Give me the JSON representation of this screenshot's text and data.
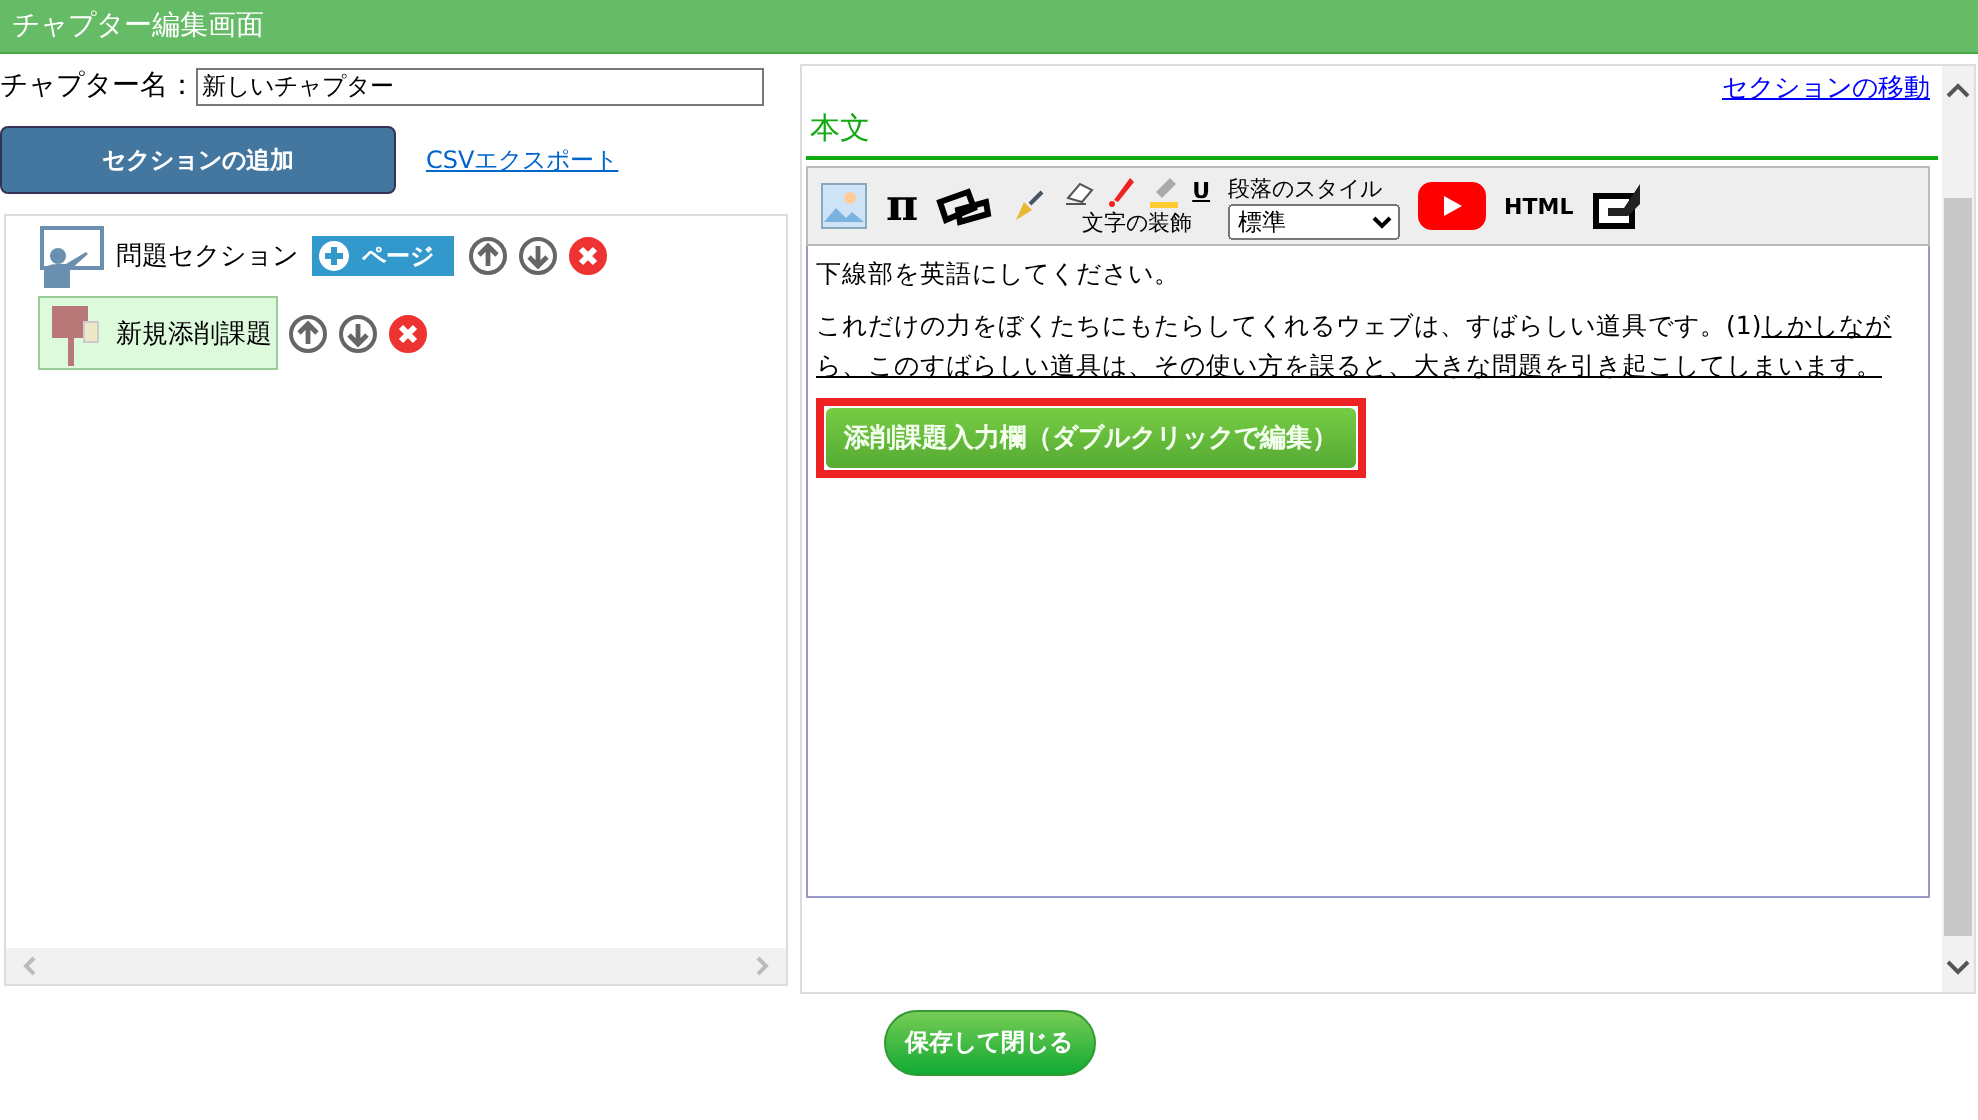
{
  "window": {
    "title": "チャプター編集画面"
  },
  "chapter_name": {
    "label": "チャプター名：",
    "value": "新しいチャプター"
  },
  "add_section_button": "セクションの追加",
  "csv_link": "CSVエクスポート",
  "tree": [
    {
      "kind": "section",
      "label": "問題セクション",
      "page_button": "ページ",
      "selected": false
    },
    {
      "kind": "task",
      "label": "新規添削課題",
      "selected": true
    }
  ],
  "move_section_link": "セクションの移動",
  "body_heading": "本文",
  "toolbar": {
    "pi": "π",
    "underline": "U",
    "decoration_label": "文字の装飾",
    "paragraph_label": "段落のスタイル",
    "paragraph_style": "標準",
    "html": "HTML"
  },
  "editor": {
    "paragraphs": [
      [
        {
          "text": "下線部を英語にしてください。",
          "underline": false
        }
      ],
      [
        {
          "text": "これだけの力をぼくたちにもたらしてくれるウェブは、すばらしい道具です。(1)",
          "underline": false
        },
        {
          "text": "しかしながら、このすばらしい道具は、その使い方を誤ると、大きな問題を引き起こしてしまいます。",
          "underline": true
        }
      ]
    ],
    "task_field": {
      "label": "添削課題入力欄（ダブルクリックで編集）",
      "selected": true
    }
  },
  "save_button": "保存して閉じる"
}
